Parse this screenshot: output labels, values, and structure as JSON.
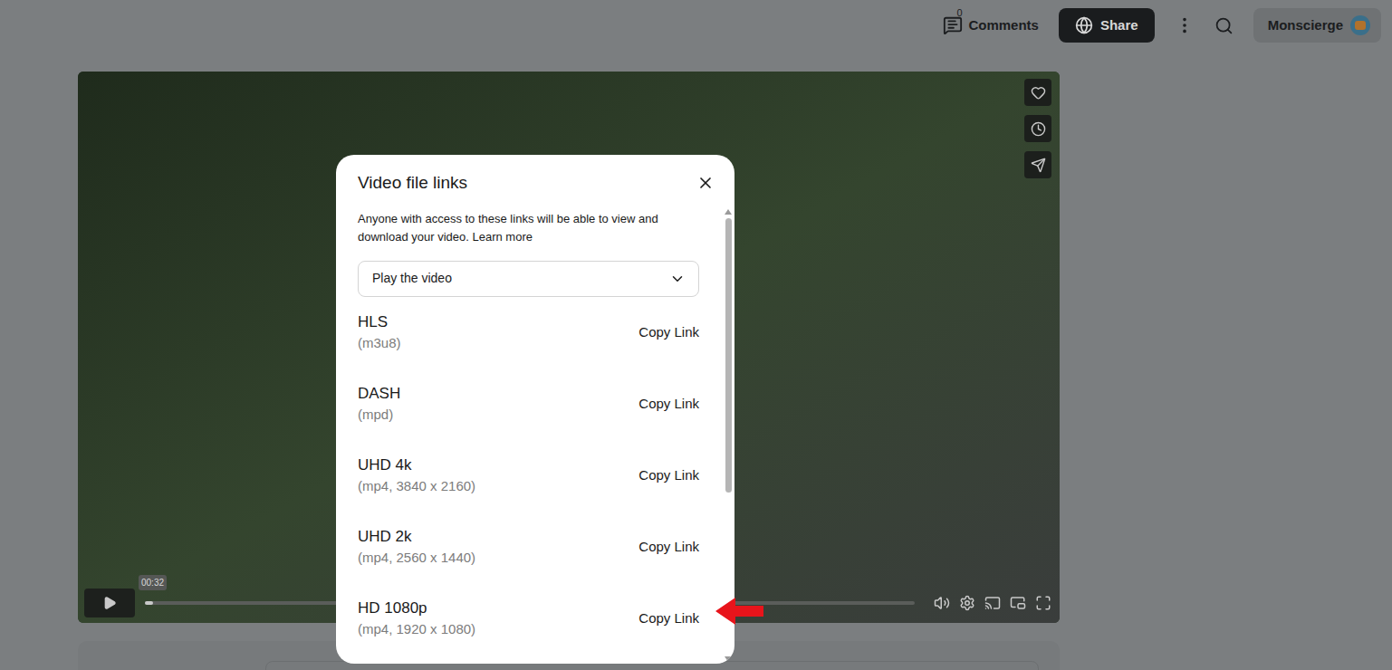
{
  "topbar": {
    "comments": {
      "label": "Comments",
      "count": "0"
    },
    "share": "Share",
    "user": "Monscierge"
  },
  "player": {
    "timestamp": "00:32",
    "level": 0.01
  },
  "dialog": {
    "title": "Video file links",
    "description": "Anyone with access to these links will be able to view and download your video.",
    "learn_more": "Learn more",
    "select": {
      "value": "Play the video"
    },
    "links": [
      {
        "name": "HLS",
        "format": "(m3u8)",
        "action": "Copy Link",
        "pointed": false
      },
      {
        "name": "DASH",
        "format": "(mpd)",
        "action": "Copy Link",
        "pointed": false
      },
      {
        "name": "UHD 4k",
        "format": "(mp4, 3840 x 2160)",
        "action": "Copy Link",
        "pointed": false
      },
      {
        "name": "UHD 2k",
        "format": "(mp4, 2560 x 1440)",
        "action": "Copy Link",
        "pointed": false
      },
      {
        "name": "HD 1080p",
        "format": "(mp4, 1920 x 1080)",
        "action": "Copy Link",
        "pointed": true
      }
    ]
  }
}
